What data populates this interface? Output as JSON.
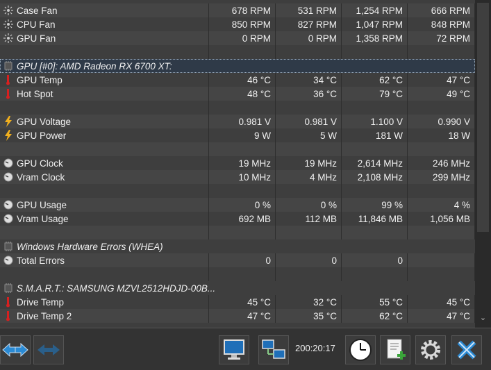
{
  "rows": [
    {
      "type": "sensor",
      "icon": "fan",
      "name": "Case Fan",
      "v": [
        "678 RPM",
        "531 RPM",
        "1,254 RPM",
        "666 RPM"
      ]
    },
    {
      "type": "sensor",
      "icon": "fan",
      "name": "CPU Fan",
      "v": [
        "850 RPM",
        "827 RPM",
        "1,047 RPM",
        "848 RPM"
      ]
    },
    {
      "type": "sensor",
      "icon": "fan",
      "name": "GPU Fan",
      "v": [
        "0 RPM",
        "0 RPM",
        "1,358 RPM",
        "72 RPM"
      ]
    },
    {
      "type": "blank"
    },
    {
      "type": "group",
      "selected": true,
      "name": "GPU [#0]: AMD Radeon RX 6700 XT:"
    },
    {
      "type": "sensor",
      "icon": "temp",
      "name": "GPU Temp",
      "v": [
        "46 °C",
        "34 °C",
        "62 °C",
        "47 °C"
      ]
    },
    {
      "type": "sensor",
      "icon": "temp",
      "name": "Hot Spot",
      "v": [
        "48 °C",
        "36 °C",
        "79 °C",
        "49 °C"
      ]
    },
    {
      "type": "blank"
    },
    {
      "type": "sensor",
      "icon": "volt",
      "name": "GPU Voltage",
      "v": [
        "0.981 V",
        "0.981 V",
        "1.100 V",
        "0.990 V"
      ]
    },
    {
      "type": "sensor",
      "icon": "volt",
      "name": "GPU Power",
      "v": [
        "9 W",
        "5 W",
        "181 W",
        "18 W"
      ]
    },
    {
      "type": "blank"
    },
    {
      "type": "sensor",
      "icon": "gauge",
      "name": "GPU Clock",
      "v": [
        "19 MHz",
        "19 MHz",
        "2,614 MHz",
        "246 MHz"
      ]
    },
    {
      "type": "sensor",
      "icon": "gauge",
      "name": "Vram Clock",
      "v": [
        "10 MHz",
        "4 MHz",
        "2,108 MHz",
        "299 MHz"
      ]
    },
    {
      "type": "blank"
    },
    {
      "type": "sensor",
      "icon": "gauge",
      "name": "GPU Usage",
      "v": [
        "0 %",
        "0 %",
        "99 %",
        "4 %"
      ]
    },
    {
      "type": "sensor",
      "icon": "gauge",
      "name": "Vram Usage",
      "v": [
        "692 MB",
        "112 MB",
        "11,846 MB",
        "1,056 MB"
      ]
    },
    {
      "type": "blank"
    },
    {
      "type": "group",
      "selected": false,
      "name": "Windows Hardware Errors (WHEA)"
    },
    {
      "type": "sensor",
      "icon": "gauge",
      "name": "Total Errors",
      "v": [
        "0",
        "0",
        "0",
        ""
      ]
    },
    {
      "type": "blank"
    },
    {
      "type": "group",
      "selected": false,
      "name": "S.M.A.R.T.: SAMSUNG MZVL2512HDJD-00B..."
    },
    {
      "type": "sensor",
      "icon": "temp",
      "name": "Drive Temp",
      "v": [
        "45 °C",
        "32 °C",
        "55 °C",
        "45 °C"
      ]
    },
    {
      "type": "sensor",
      "icon": "temp",
      "name": "Drive Temp 2",
      "v": [
        "47 °C",
        "35 °C",
        "62 °C",
        "47 °C"
      ]
    }
  ],
  "toolbar": {
    "elapsed_time": "200:20:17",
    "buttons": [
      "nav-arrows-icon",
      "nav-arrows-disabled-icon",
      "monitor-icon",
      "network-icon",
      "clock-icon",
      "report-add-icon",
      "gear-icon",
      "close-icon"
    ]
  },
  "colors": {
    "accent_blue": "#2a8ad4",
    "temp_red": "#d62020",
    "volt_yellow": "#f2b01e"
  }
}
